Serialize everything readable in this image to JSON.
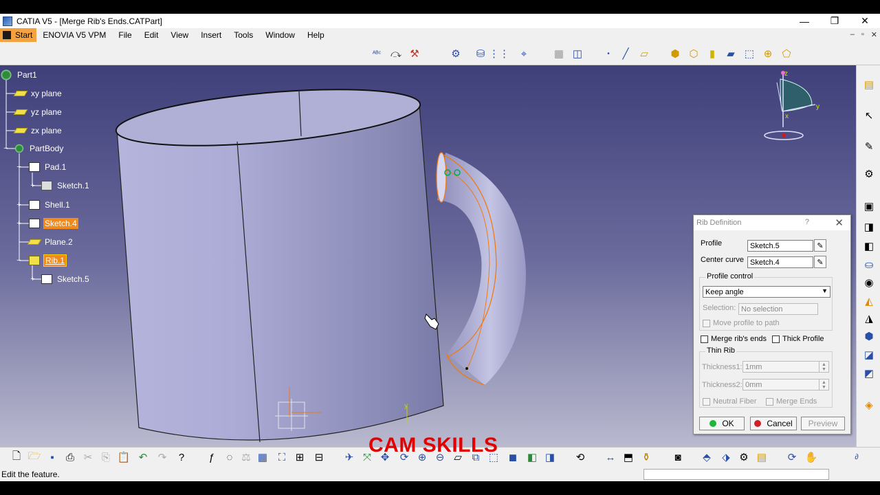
{
  "window": {
    "title": "CATIA V5 - [Merge Rib's Ends.CATPart]",
    "controls": [
      "—",
      "❐",
      "✕"
    ]
  },
  "menubar": {
    "items": [
      "Start",
      "ENOVIA V5 VPM",
      "File",
      "Edit",
      "View",
      "Insert",
      "Tools",
      "Window",
      "Help"
    ],
    "mdi_controls": [
      "–",
      "▫",
      "✕"
    ]
  },
  "tree": {
    "root": "Part1",
    "items": [
      {
        "label": "xy plane"
      },
      {
        "label": "yz plane"
      },
      {
        "label": "zx plane"
      },
      {
        "label": "PartBody"
      },
      {
        "label": "Pad.1"
      },
      {
        "label": "Sketch.1"
      },
      {
        "label": "Shell.1"
      },
      {
        "label": "Sketch.4"
      },
      {
        "label": "Plane.2"
      },
      {
        "label": "Rib.1"
      },
      {
        "label": "Sketch.5"
      }
    ]
  },
  "compass": {
    "z": "z",
    "y": "y",
    "x": "x"
  },
  "dialog": {
    "title": "Rib Definition",
    "help": "?",
    "close": "✕",
    "profile_label": "Profile",
    "profile_value": "Sketch.5",
    "center_curve_label": "Center curve",
    "center_curve_value": "Sketch.4",
    "profile_control_group": "Profile control",
    "profile_control_value": "Keep angle",
    "selection_label": "Selection:",
    "selection_value": "No selection",
    "move_profile_label": "Move profile to path",
    "merge_ribs_ends_label": "Merge rib's ends",
    "thick_profile_label": "Thick Profile",
    "thin_rib_group": "Thin Rib",
    "thickness1_label": "Thickness1:",
    "thickness1_value": "1mm",
    "thickness2_label": "Thickness2:",
    "thickness2_value": "0mm",
    "neutral_fiber_label": "Neutral Fiber",
    "merge_ends_label": "Merge Ends",
    "ok_label": "OK",
    "cancel_label": "Cancel",
    "preview_label": "Preview",
    "colors": {
      "ok_dot": "#1db83a",
      "cancel_dot": "#d0202a"
    }
  },
  "watermark": "CAM SKILLS",
  "status": {
    "message": "Edit the feature."
  },
  "colors": {
    "selection_highlight": "#f08a1c",
    "viewport_top": "#3f3f7a",
    "viewport_bottom": "#b9b9cf",
    "watermark": "#e30000"
  }
}
